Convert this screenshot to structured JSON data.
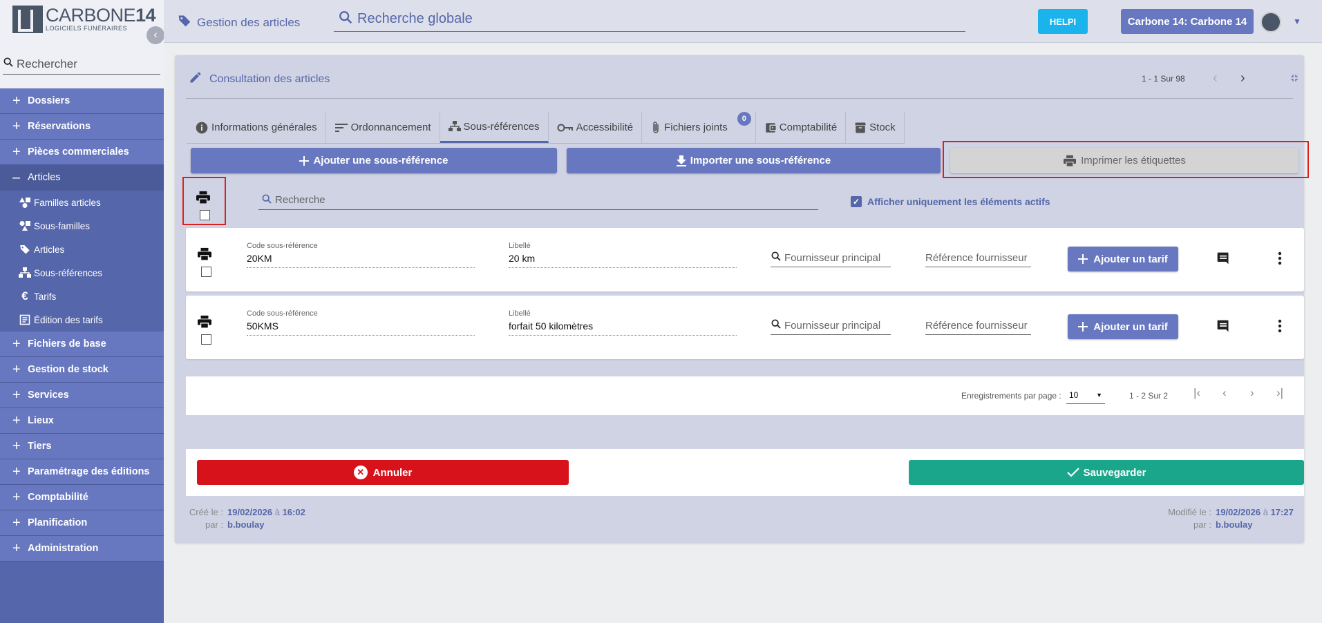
{
  "brand": {
    "title_main": "CARBONE",
    "title_num": "14",
    "subtitle": "LOGICIELS FUNÉRAIRES"
  },
  "sidebar": {
    "search_placeholder": "Rechercher",
    "items": [
      {
        "label": "Dossiers"
      },
      {
        "label": "Réservations"
      },
      {
        "label": "Pièces commerciales"
      },
      {
        "label": "Articles"
      },
      {
        "label": "Fichiers de base"
      },
      {
        "label": "Gestion de stock"
      },
      {
        "label": "Services"
      },
      {
        "label": "Lieux"
      },
      {
        "label": "Tiers"
      },
      {
        "label": "Paramétrage des éditions"
      },
      {
        "label": "Comptabilité"
      },
      {
        "label": "Planification"
      },
      {
        "label": "Administration"
      }
    ],
    "subitems": [
      {
        "label": "Familles articles",
        "icon": "shapes-icon"
      },
      {
        "label": "Sous-familles",
        "icon": "shapes-icon"
      },
      {
        "label": "Articles",
        "icon": "tag-icon"
      },
      {
        "label": "Sous-références",
        "icon": "hierarchy-icon"
      },
      {
        "label": "Tarifs",
        "icon": "euro-icon"
      },
      {
        "label": "Édition des tarifs",
        "icon": "edit-doc-icon"
      }
    ]
  },
  "topbar": {
    "section": "Gestion des articles",
    "search_placeholder": "Recherche globale",
    "help": "HELPI",
    "user": "Carbone 14: Carbone 14"
  },
  "panel": {
    "title": "Consultation des articles",
    "pager": "1 - 1 Sur 98",
    "tabs": [
      {
        "label": "Informations générales"
      },
      {
        "label": "Ordonnancement"
      },
      {
        "label": "Sous-références"
      },
      {
        "label": "Accessibilité"
      },
      {
        "label": "Fichiers joints",
        "badge": "0"
      },
      {
        "label": "Comptabilité"
      },
      {
        "label": "Stock"
      }
    ],
    "actions": {
      "add": "Ajouter une sous-référence",
      "import": "Importer une sous-référence",
      "print": "Imprimer les étiquettes"
    },
    "filter": {
      "search_placeholder": "Recherche",
      "active_only": "Afficher uniquement les éléments actifs"
    },
    "rows": [
      {
        "code_label": "Code sous-référence",
        "code": "20KM",
        "libelle_label": "Libellé",
        "libelle": "20 km",
        "supplier": "Fournisseur principal",
        "supplier_ref": "Référence fournisseur",
        "add_tarif": "Ajouter un tarif"
      },
      {
        "code_label": "Code sous-référence",
        "code": "50KMS",
        "libelle_label": "Libellé",
        "libelle": "forfait 50 kilomètres",
        "supplier": "Fournisseur principal",
        "supplier_ref": "Référence fournisseur",
        "add_tarif": "Ajouter un tarif"
      }
    ],
    "paginator": {
      "label": "Enregistrements par page :",
      "per_page": "10",
      "range": "1 - 2 Sur 2"
    },
    "buttons": {
      "cancel": "Annuler",
      "save": "Sauvegarder"
    },
    "meta": {
      "created_label": "Créé le :",
      "created_date": "19/02/2026",
      "created_at": "à",
      "created_time": "16:02",
      "by_label": "par :",
      "created_by": "b.boulay",
      "modified_label": "Modifié le :",
      "modified_date": "19/02/2026",
      "modified_at": "à",
      "modified_time": "17:27",
      "modified_by": "b.boulay"
    }
  },
  "colors": {
    "accent": "#5566aa",
    "button": "#6878c0",
    "helpi": "#1ab3ec",
    "cancel": "#d7121b",
    "save": "#1aa68a",
    "highlight": "#e01e1e"
  }
}
